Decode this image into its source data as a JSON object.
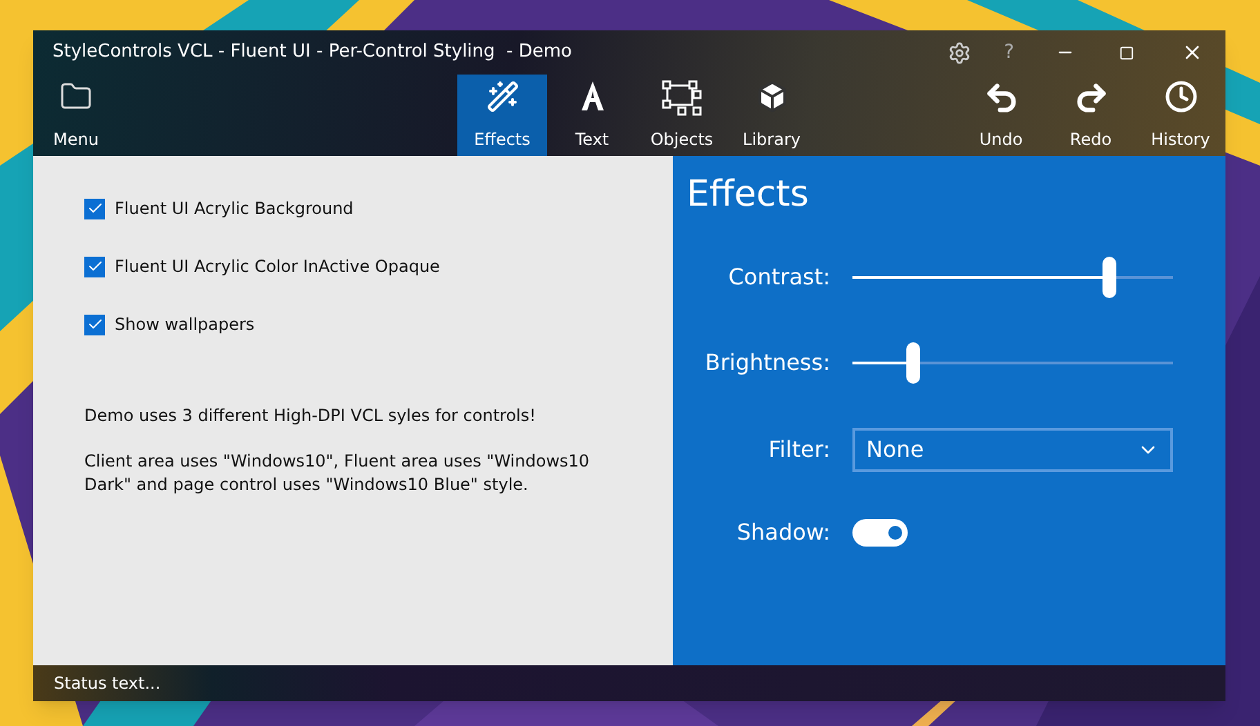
{
  "window": {
    "title": "StyleControls VCL - Fluent UI - Per-Control Styling  - Demo",
    "help": "?"
  },
  "toolbar": {
    "left": [
      {
        "label": "Menu",
        "selected": false
      }
    ],
    "tabs": [
      {
        "label": "Effects",
        "selected": true
      },
      {
        "label": "Text",
        "selected": false
      },
      {
        "label": "Objects",
        "selected": false
      },
      {
        "label": "Library",
        "selected": false
      }
    ],
    "actions": [
      {
        "label": "Undo"
      },
      {
        "label": "Redo"
      },
      {
        "label": "History"
      }
    ]
  },
  "options": [
    {
      "label": "Fluent UI Acrylic Background",
      "checked": true
    },
    {
      "label": "Fluent UI Acrylic Color InActive Opaque",
      "checked": true
    },
    {
      "label": "Show wallpapers",
      "checked": true
    }
  ],
  "notes": [
    "Demo uses 3 different High-DPI VCL syles for controls!",
    "Client area uses \"Windows10\", Fluent area uses \"Windows10 Dark\" and page control uses \"Windows10 Blue\" style."
  ],
  "panel": {
    "title": "Effects",
    "controls": [
      {
        "kind": "slider",
        "label": "Contrast:",
        "level": 0.8
      },
      {
        "kind": "slider",
        "label": "Brightness:",
        "level": 0.19
      },
      {
        "kind": "select",
        "label": "Filter:",
        "value": "None"
      },
      {
        "kind": "toggle",
        "label": "Shadow:",
        "on": true
      }
    ]
  },
  "status_bar": {
    "text": "Status text..."
  }
}
